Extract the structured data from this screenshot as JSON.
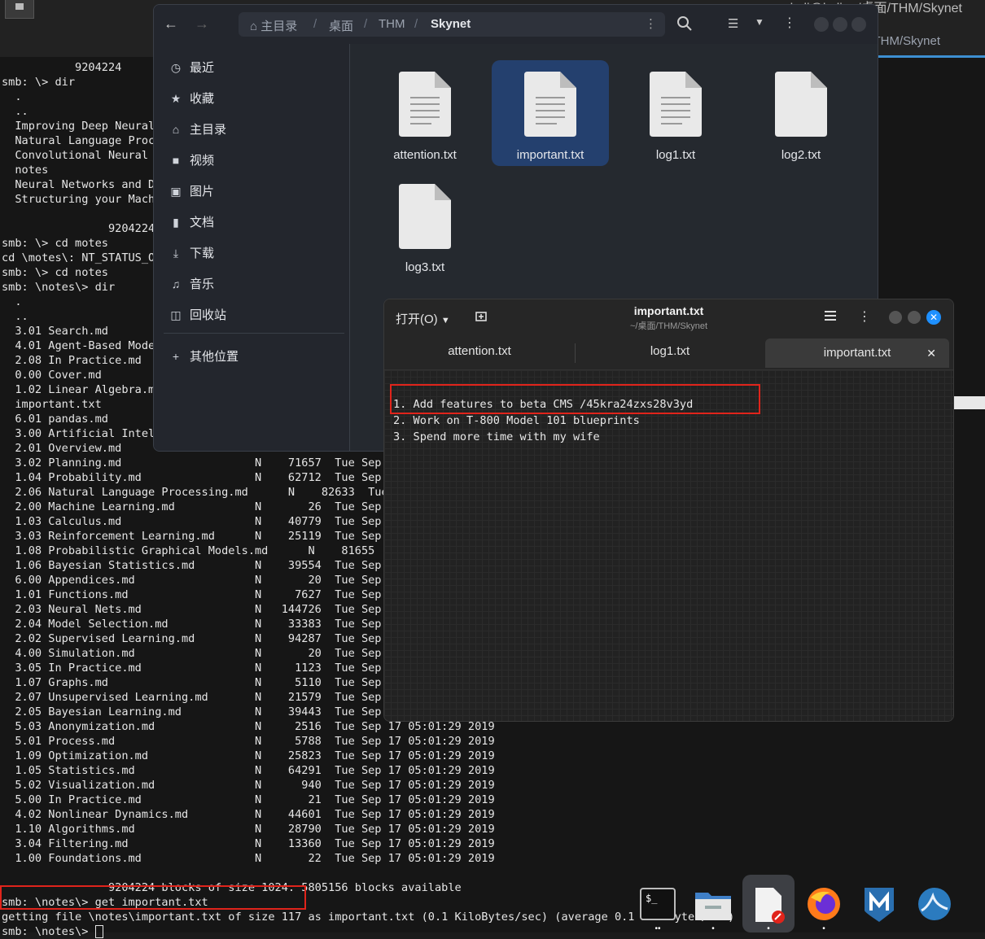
{
  "terminal": {
    "title": "kali@kali: ~/桌面/THM/Skynet",
    "tab_label": "THM/Skynet",
    "lines": [
      "           9204224",
      "smb: \\> dir",
      "  .",
      "  ..",
      "  Improving Deep Neural",
      "  Natural Language Proce",
      "  Convolutional Neural N",
      "  notes",
      "  Neural Networks and De",
      "  Structuring your Machi",
      "",
      "                9204224",
      "smb: \\> cd motes",
      "cd \\motes\\: NT_STATUS_OB",
      "smb: \\> cd notes",
      "smb: \\notes\\> dir",
      "  .",
      "  ..",
      "  3.01 Search.md",
      "  4.01 Agent-Based Model",
      "  2.08 In Practice.md",
      "  0.00 Cover.md",
      "  1.02 Linear Algebra.md",
      "  important.txt",
      "  6.01 pandas.md",
      "  3.00 Artificial Intell",
      "  2.01 Overview.md",
      "  3.02 Planning.md                    N    71657  Tue Sep 1",
      "  1.04 Probability.md                 N    62712  Tue Sep 1",
      "  2.06 Natural Language Processing.md      N    82633  Tue",
      "  2.00 Machine Learning.md            N       26  Tue Sep 1",
      "  1.03 Calculus.md                    N    40779  Tue Sep 1",
      "  3.03 Reinforcement Learning.md      N    25119  Tue Sep 1",
      "  1.08 Probabilistic Graphical Models.md      N    81655  T",
      "  1.06 Bayesian Statistics.md         N    39554  Tue Sep 1",
      "  6.00 Appendices.md                  N       20  Tue Sep 1",
      "  1.01 Functions.md                   N     7627  Tue Sep 1",
      "  2.03 Neural Nets.md                 N   144726  Tue Sep 1",
      "  2.04 Model Selection.md             N    33383  Tue Sep 1",
      "  2.02 Supervised Learning.md         N    94287  Tue Sep 1",
      "  4.00 Simulation.md                  N       20  Tue Sep 1",
      "  3.05 In Practice.md                 N     1123  Tue Sep 1",
      "  1.07 Graphs.md                      N     5110  Tue Sep 1",
      "  2.07 Unsupervised Learning.md       N    21579  Tue Sep 1",
      "  2.05 Bayesian Learning.md           N    39443  Tue Sep 1",
      "  5.03 Anonymization.md               N     2516  Tue Sep 17 05:01:29 2019",
      "  5.01 Process.md                     N     5788  Tue Sep 17 05:01:29 2019",
      "  1.09 Optimization.md                N    25823  Tue Sep 17 05:01:29 2019",
      "  1.05 Statistics.md                  N    64291  Tue Sep 17 05:01:29 2019",
      "  5.02 Visualization.md               N      940  Tue Sep 17 05:01:29 2019",
      "  5.00 In Practice.md                 N       21  Tue Sep 17 05:01:29 2019",
      "  4.02 Nonlinear Dynamics.md          N    44601  Tue Sep 17 05:01:29 2019",
      "  1.10 Algorithms.md                  N    28790  Tue Sep 17 05:01:29 2019",
      "  3.04 Filtering.md                   N    13360  Tue Sep 17 05:01:29 2019",
      "  1.00 Foundations.md                 N       22  Tue Sep 17 05:01:29 2019",
      "",
      "                9204224 blocks of size 1024. 5805156 blocks available",
      "smb: \\notes\\> get important.txt",
      "getting file \\notes\\important.txt of size 117 as important.txt (0.1 KiloBytes/sec) (average 0.1 KiloBytes/sec)",
      "smb: \\notes\\> "
    ]
  },
  "file_manager": {
    "breadcrumb": [
      "主目录",
      "桌面",
      "THM",
      "Skynet"
    ],
    "sidebar": [
      {
        "icon": "clock-icon",
        "label": "最近"
      },
      {
        "icon": "star-icon",
        "label": "收藏"
      },
      {
        "icon": "home-icon",
        "label": "主目录"
      },
      {
        "icon": "video-icon",
        "label": "视频"
      },
      {
        "icon": "picture-icon",
        "label": "图片"
      },
      {
        "icon": "document-icon",
        "label": "文档"
      },
      {
        "icon": "download-icon",
        "label": "下载"
      },
      {
        "icon": "music-icon",
        "label": "音乐"
      },
      {
        "icon": "trash-icon",
        "label": "回收站"
      }
    ],
    "other_locations": "其他位置",
    "files": [
      {
        "name": "attention.txt",
        "has_text": true,
        "selected": false
      },
      {
        "name": "important.txt",
        "has_text": true,
        "selected": true
      },
      {
        "name": "log1.txt",
        "has_text": true,
        "selected": false
      },
      {
        "name": "log2.txt",
        "has_text": false,
        "selected": false
      },
      {
        "name": "log3.txt",
        "has_text": false,
        "selected": false
      }
    ]
  },
  "editor": {
    "open_label": "打开(O)",
    "title": "important.txt",
    "path": "~/桌面/THM/Skynet",
    "tabs": [
      "attention.txt",
      "log1.txt",
      "important.txt"
    ],
    "active_tab": 2,
    "lines": [
      "1. Add features to beta CMS /45kra24zxs28v3yd",
      "2. Work on T-800 Model 101 blueprints",
      "3. Spend more time with my wife"
    ]
  },
  "dock": [
    {
      "name": "terminal-app",
      "dots": "••"
    },
    {
      "name": "files-app",
      "dots": "•"
    },
    {
      "name": "text-editor-app",
      "dots": "•"
    },
    {
      "name": "firefox-app",
      "dots": "•"
    },
    {
      "name": "metasploit-app",
      "dots": ""
    },
    {
      "name": "wireshark-app",
      "dots": ""
    }
  ],
  "colors": {
    "accent": "#3d8fd1",
    "selection": "#24406e",
    "highlight_box": "#e0241b"
  }
}
